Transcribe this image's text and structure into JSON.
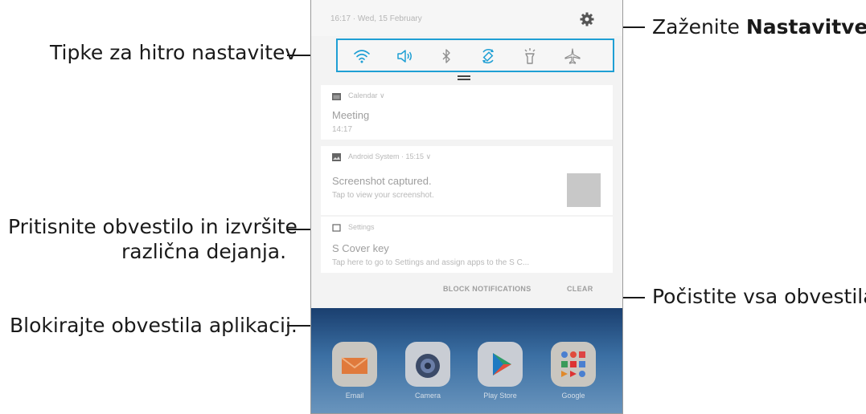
{
  "phone": {
    "status_text": "16:17 · Wed, 15 February",
    "quick_settings": [
      "wifi-icon",
      "sound-icon",
      "bluetooth-icon",
      "auto-rotate-icon",
      "flashlight-icon",
      "airplane-icon"
    ],
    "notifications": [
      {
        "app": "Calendar ∨",
        "title": "Meeting",
        "subtitle": "14:17"
      },
      {
        "app": "Android System · 15:15 ∨",
        "title": "Screenshot captured.",
        "subtitle": "Tap to view your screenshot."
      },
      {
        "app": "Settings",
        "title": "S Cover key",
        "subtitle": "Tap here to go to Settings and assign apps to the S C..."
      }
    ],
    "actions": {
      "block": "BLOCK NOTIFICATIONS",
      "clear": "CLEAR"
    },
    "home_apps": [
      "Email",
      "Camera",
      "Play Store",
      "Google"
    ]
  },
  "callouts": {
    "quick_settings": "Tipke za hitro nastavitev",
    "notification_line1": "Pritisnite obvestilo in izvršite",
    "notification_line2": "različna dejanja.",
    "block": "Blokirajte obvestila aplikacij.",
    "settings_prefix": "Zaženite ",
    "settings_bold": "Nastavitve",
    "settings_suffix": ".",
    "clear": "Počistite vsa obvestila."
  },
  "colors": {
    "accent": "#1f9fd4",
    "home_top": "#1a3f6f",
    "home_bottom": "#6a95bd"
  }
}
